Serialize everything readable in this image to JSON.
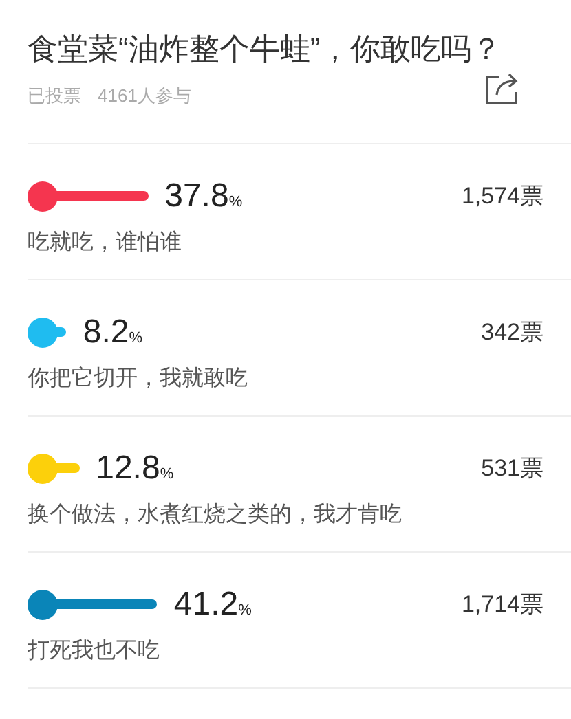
{
  "poll": {
    "title": "食堂菜“油炸整个牛蛙”，你敢吃吗？",
    "status": "已投票",
    "participants": "4161人参与",
    "options": [
      {
        "color": "#f5354f",
        "percent": "37.8",
        "percent_sign": "%",
        "votes": "1,574票",
        "label": "吃就吃，谁怕谁"
      },
      {
        "color": "#1fbcf0",
        "percent": "8.2",
        "percent_sign": "%",
        "votes": "342票",
        "label": "你把它切开，我就敢吃"
      },
      {
        "color": "#fcd00b",
        "percent": "12.8",
        "percent_sign": "%",
        "votes": "531票",
        "label": "换个做法，水煮红烧之类的，我才肯吃"
      },
      {
        "color": "#0a85b8",
        "percent": "41.2",
        "percent_sign": "%",
        "votes": "1,714票",
        "label": "打死我也不吃"
      }
    ]
  }
}
